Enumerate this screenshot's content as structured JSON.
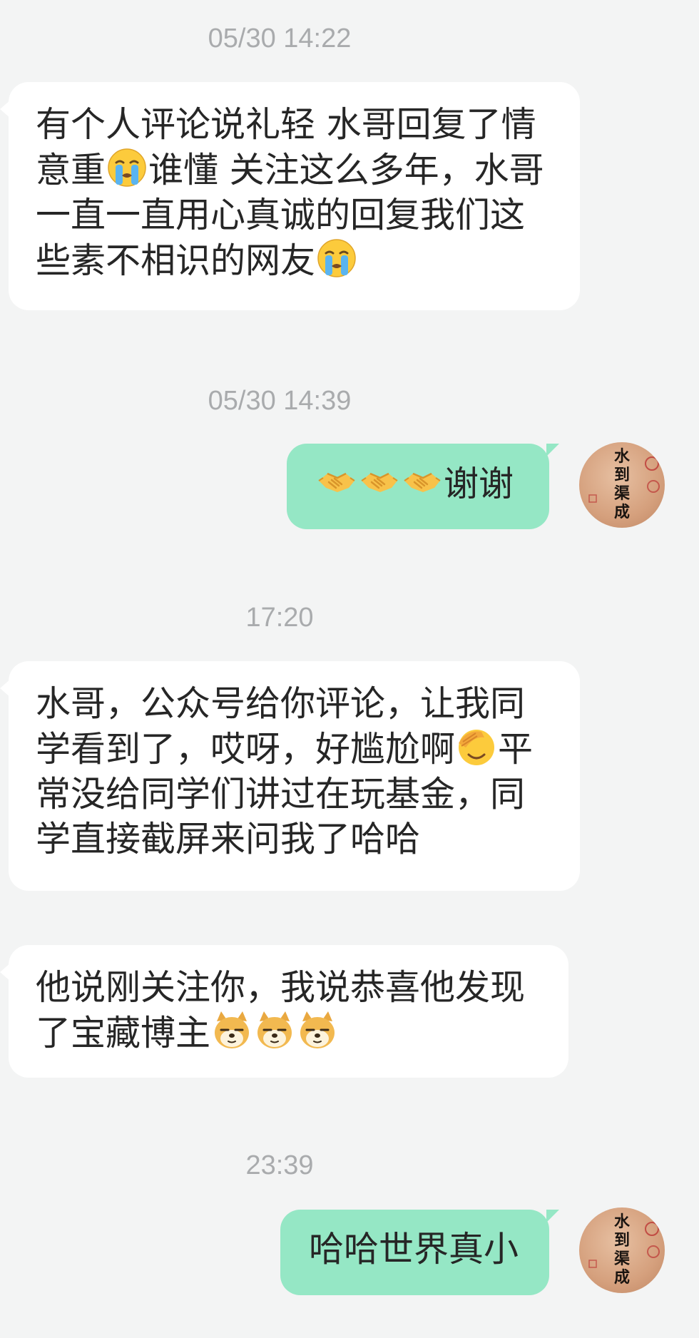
{
  "colors": {
    "background": "#f3f4f4",
    "incoming_bubble": "#ffffff",
    "outgoing_bubble": "#95e7c5",
    "timestamp": "#a9abad",
    "text": "#262626"
  },
  "timestamps": {
    "t1": "05/30 14:22",
    "t2": "05/30 14:39",
    "t3": "17:20",
    "t4": "23:39"
  },
  "messages": {
    "m1": {
      "direction": "incoming",
      "p1": "有个人评论说礼轻 水哥回复了情意重",
      "emoji1": "loudly-crying-face-emoji",
      "p2": "谁懂 关注这么多年，水哥一直一直用心真诚的回复我们这些素不相识的网友",
      "emoji2": "loudly-crying-face-emoji"
    },
    "m2": {
      "direction": "outgoing",
      "emojis": [
        "handshake-emoji",
        "handshake-emoji",
        "handshake-emoji"
      ],
      "text": "谢谢"
    },
    "m3": {
      "direction": "incoming",
      "p1": "水哥，公众号给你评论，让我同学看到了，哎呀，好尴尬啊",
      "emoji1": "face-palm-emoji",
      "p2": "平常没给同学们讲过在玩基金，同学直接截屏来问我了哈哈"
    },
    "m4": {
      "direction": "incoming",
      "text": "他说刚关注你，我说恭喜他发现了宝藏博主",
      "emojis": [
        "doge-emoji",
        "doge-emoji",
        "doge-emoji"
      ]
    },
    "m5": {
      "direction": "outgoing",
      "text": "哈哈世界真小"
    }
  },
  "avatar": {
    "icon": "calligraphy-seal-avatar",
    "calligraphy": "水到渠成"
  }
}
